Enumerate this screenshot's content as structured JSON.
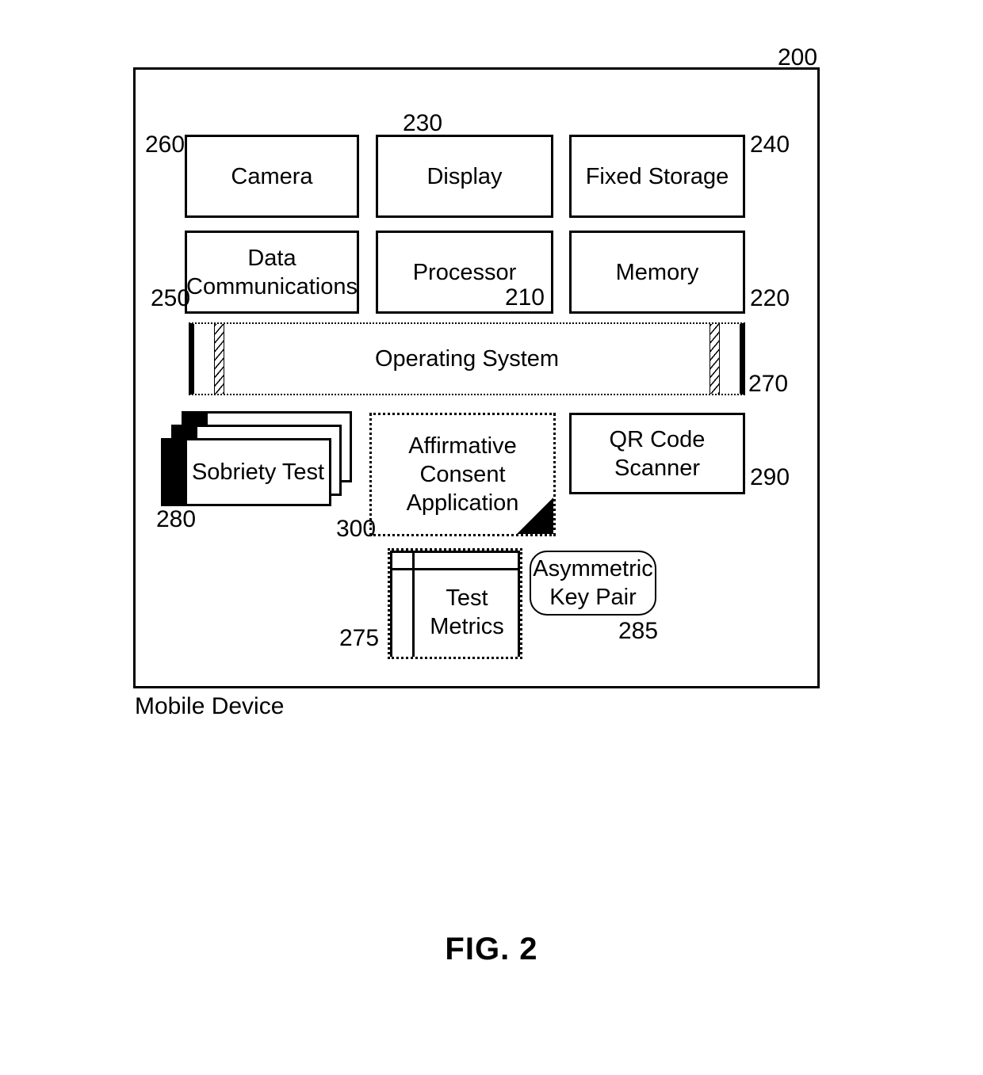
{
  "figure": {
    "caption": "FIG. 2",
    "device_caption": "Mobile Device",
    "frame_ref": "200"
  },
  "components": {
    "camera": {
      "label": "Camera",
      "ref": "260"
    },
    "display": {
      "label": "Display",
      "ref": "230"
    },
    "fixed_storage": {
      "label": "Fixed Storage",
      "ref": "240"
    },
    "data_comms": {
      "label": "Data\nCommunications",
      "ref": "250"
    },
    "data_comms_line1": "Data",
    "data_comms_line2": "Communications",
    "processor": {
      "label": "Processor",
      "ref": "210"
    },
    "memory": {
      "label": "Memory",
      "ref": "220"
    },
    "operating_system": {
      "label": "Operating System",
      "ref": "270"
    },
    "sobriety_test": {
      "label": "Sobriety Test",
      "ref": "280"
    },
    "consent_app": {
      "label": "Affirmative Consent Application",
      "ref": "300"
    },
    "consent_line1": "Affirmative",
    "consent_line2": "Consent",
    "consent_line3": "Application",
    "qr_scanner": {
      "label": "QR Code Scanner",
      "ref": "290"
    },
    "qr_line1": "QR Code",
    "qr_line2": "Scanner",
    "test_metrics": {
      "label": "Test Metrics",
      "ref": "275"
    },
    "test_metrics_line1": "Test",
    "test_metrics_line2": "Metrics",
    "key_pair": {
      "label": "Asymmetric Key Pair",
      "ref": "285"
    },
    "key_pair_line1": "Asymmetric",
    "key_pair_line2": "Key Pair"
  },
  "colors": {
    "line": "#000000",
    "background": "#ffffff"
  }
}
